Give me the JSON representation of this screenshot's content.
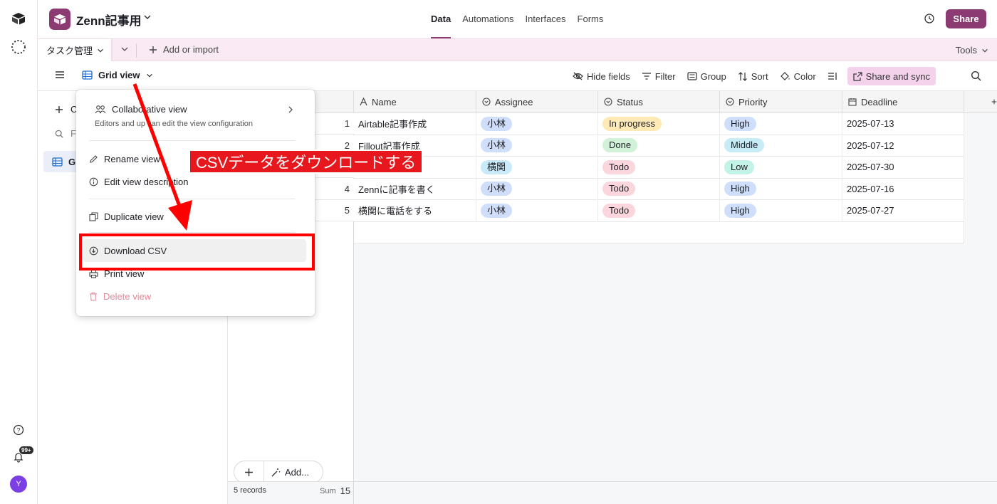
{
  "base": {
    "title": "Zenn記事用"
  },
  "tabs": [
    "Data",
    "Automations",
    "Interfaces",
    "Forms"
  ],
  "share_label": "Share",
  "notification_badge": "99+",
  "avatar_letter": "Y",
  "tablebar": {
    "table_name": "タスク管理",
    "add_import": "Add or import",
    "tools": "Tools"
  },
  "viewbar": {
    "view_name": "Grid view",
    "actions": [
      "Hide fields",
      "Filter",
      "Group",
      "Sort",
      "Color"
    ],
    "share_sync": "Share and sync"
  },
  "sidebar": {
    "create": "C",
    "find": "Fi",
    "grid_item": "Gr"
  },
  "columns": [
    "Name",
    "Assignee",
    "Status",
    "Priority",
    "Deadline"
  ],
  "rows": [
    {
      "num": "1",
      "name": "Airtable記事作成",
      "assignee": "小林",
      "status": "In progress",
      "priority": "High",
      "deadline": "2025-07-13"
    },
    {
      "num": "2",
      "name": "Fillout記事作成",
      "assignee": "小林",
      "status": "Done",
      "priority": "Middle",
      "deadline": "2025-07-12"
    },
    {
      "num": "",
      "name": "",
      "assignee": "横関",
      "status": "Todo",
      "priority": "Low",
      "deadline": "2025-07-30"
    },
    {
      "num": "4",
      "name": "Zennに記事を書く",
      "assignee": "小林",
      "status": "Todo",
      "priority": "High",
      "deadline": "2025-07-16"
    },
    {
      "num": "5",
      "name": "横関に電話をする",
      "assignee": "小林",
      "status": "Todo",
      "priority": "High",
      "deadline": "2025-07-27"
    }
  ],
  "footer": {
    "records": "5 records",
    "sum_label": "Sum",
    "sum_value": "15",
    "add_more": "Add..."
  },
  "menu": {
    "collab_title": "Collaborative view",
    "collab_desc": "Editors and up can edit the view configuration",
    "rename": "Rename view",
    "edit_desc": "Edit view description",
    "duplicate": "Duplicate view",
    "download": "Download CSV",
    "print": "Print view",
    "delete": "Delete view"
  },
  "annotation": {
    "callout": "CSVデータをダウンロードする"
  },
  "colors": {
    "brand": "#8c3a72",
    "annotation_red": "#ff0000"
  }
}
